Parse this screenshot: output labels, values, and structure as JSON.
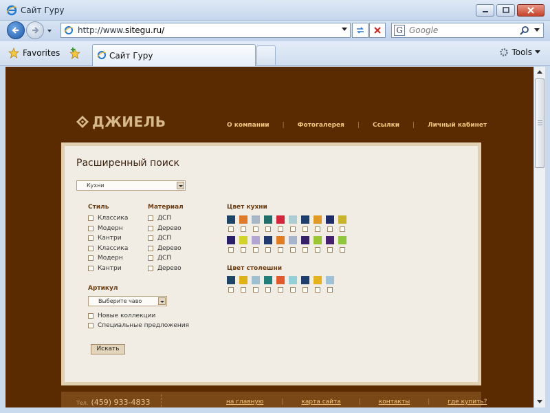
{
  "window": {
    "title": "Сайт Гуру"
  },
  "navbar": {
    "url_prefix": "http://www.",
    "url_host": "sitegu.ru/",
    "search_placeholder": "Google",
    "search_engine_letter": "G"
  },
  "tabbar": {
    "favorites_label": "Favorites",
    "tab_label": "Сайт Гуру",
    "tools_label": "Tools"
  },
  "site": {
    "logo_text": "ДЖИЕЛЬ",
    "nav": [
      "О компании",
      "Фотогалерея",
      "Ссылки",
      "Личный кабинет"
    ],
    "nav_separator": "|",
    "panel_title": "Расширенный поиск",
    "category_select": "Кухни",
    "style": {
      "label": "Стиль",
      "options": [
        "Классика",
        "Модерн",
        "Кантри",
        "Классика",
        "Модерн",
        "Кантри"
      ]
    },
    "material": {
      "label": "Материал",
      "options": [
        "ДСП",
        "Дерево",
        "ДСП",
        "Дерево",
        "ДСП",
        "Дерево"
      ]
    },
    "kitchen_color": {
      "label": "Цвет кухни",
      "colors_row1": [
        "#1e4466",
        "#e07a2b",
        "#a6b8c8",
        "#1f6e6a",
        "#d6253a",
        "#a9cfd2",
        "#1c3f6e",
        "#e09a23",
        "#1f2c6a",
        "#c8b42c"
      ],
      "colors_row2": [
        "#2a1f6a",
        "#d3d227",
        "#b1a6d3",
        "#1f3a6e",
        "#e07d22",
        "#a6b5cd",
        "#36206b",
        "#9bc631",
        "#45206e",
        "#8fc63a"
      ]
    },
    "countertop_color": {
      "label": "Цвет столешни",
      "colors": [
        "#1e4466",
        "#e0b114",
        "#9cbfd1",
        "#1f7f7a",
        "#e0582b",
        "#8fd0d9",
        "#1c3f6e",
        "#e3b21d",
        "#9fc2d8"
      ]
    },
    "article": {
      "label": "Артикул",
      "select_value": "Выберите чаво",
      "options": [
        "Новые коллекции",
        "Специальные предложения"
      ]
    },
    "search_button": "Искать",
    "footer": {
      "phone_prefix": "Тел.",
      "phone": "(459) 933-4833",
      "links": [
        "на главную",
        "карта сайта",
        "контакты",
        "где купить?"
      ],
      "separator": "|"
    }
  }
}
